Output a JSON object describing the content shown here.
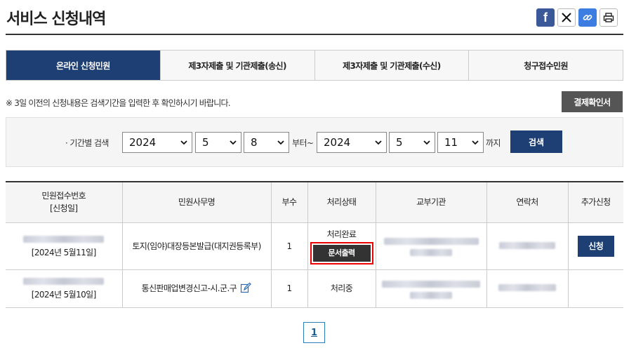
{
  "page": {
    "title": "서비스 신청내역"
  },
  "share": {
    "icons": [
      "facebook-icon",
      "x-twitter-icon",
      "link-icon",
      "print-icon"
    ],
    "facebook_glyph": "f"
  },
  "tabs": [
    {
      "label": "온라인 신청민원",
      "active": true
    },
    {
      "label": "제3자제출 및 기관제출(송신)",
      "active": false
    },
    {
      "label": "제3자제출 및 기관제출(수신)",
      "active": false
    },
    {
      "label": "청구접수민원",
      "active": false
    }
  ],
  "notice": "※ 3일 이전의 신청내용은 검색기간을 입력한 후 확인하시기 바랍니다.",
  "confirm_button": "결제확인서",
  "search": {
    "label": "· 기간별 검색",
    "from": {
      "year": "2024",
      "month": "5",
      "day": "8"
    },
    "from_suffix": "부터~",
    "to": {
      "year": "2024",
      "month": "5",
      "day": "11"
    },
    "to_suffix": "까지",
    "button": "검색"
  },
  "table": {
    "headers": {
      "receipt_line1": "민원접수번호",
      "receipt_line2": "[신청일]",
      "service": "민원사무명",
      "copies": "부수",
      "status": "처리상태",
      "agency": "교부기관",
      "contact": "연락처",
      "extra": "추가신청"
    },
    "rows": [
      {
        "date": "[2024년 5월11일]",
        "service": "토지(임야)대장등본발급(대지권등록부)",
        "copies": "1",
        "status": "처리완료",
        "print_button": "문서출력",
        "apply_button": "신청"
      },
      {
        "date": "[2024년 5월10일]",
        "service": "통신판매업변경신고-시.군.구",
        "copies": "1",
        "status": "처리중"
      }
    ]
  },
  "pagination": {
    "current": "1"
  },
  "colors": {
    "primary": "#1e3f73",
    "highlight": "#e00000",
    "dark_button": "#555555"
  }
}
